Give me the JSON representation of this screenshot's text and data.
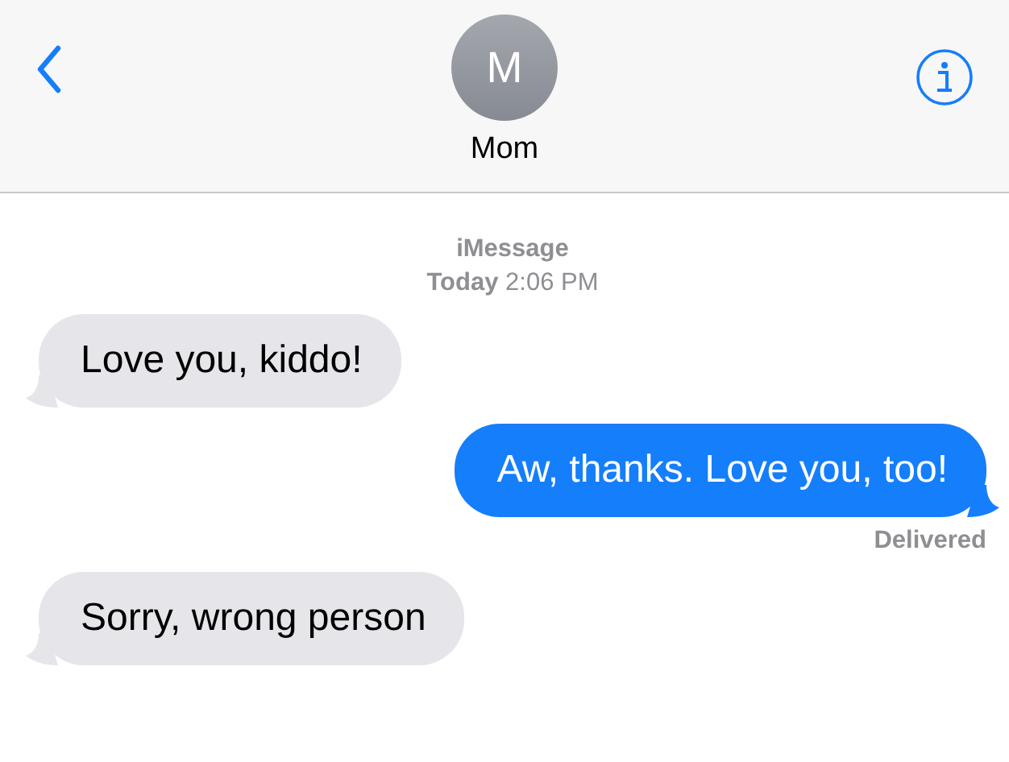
{
  "contact": {
    "initial": "M",
    "name": "Mom"
  },
  "thread": {
    "service": "iMessage",
    "timestamp": "**Today** 2:06 PM"
  },
  "messages": [
    {
      "kind": "received",
      "text": "Love you, kiddo!"
    },
    {
      "kind": "sent",
      "text": "Aw, thanks. Love you, too!",
      "status": "Delivered"
    },
    {
      "kind": "received",
      "text": "Sorry, wrong person"
    }
  ]
}
